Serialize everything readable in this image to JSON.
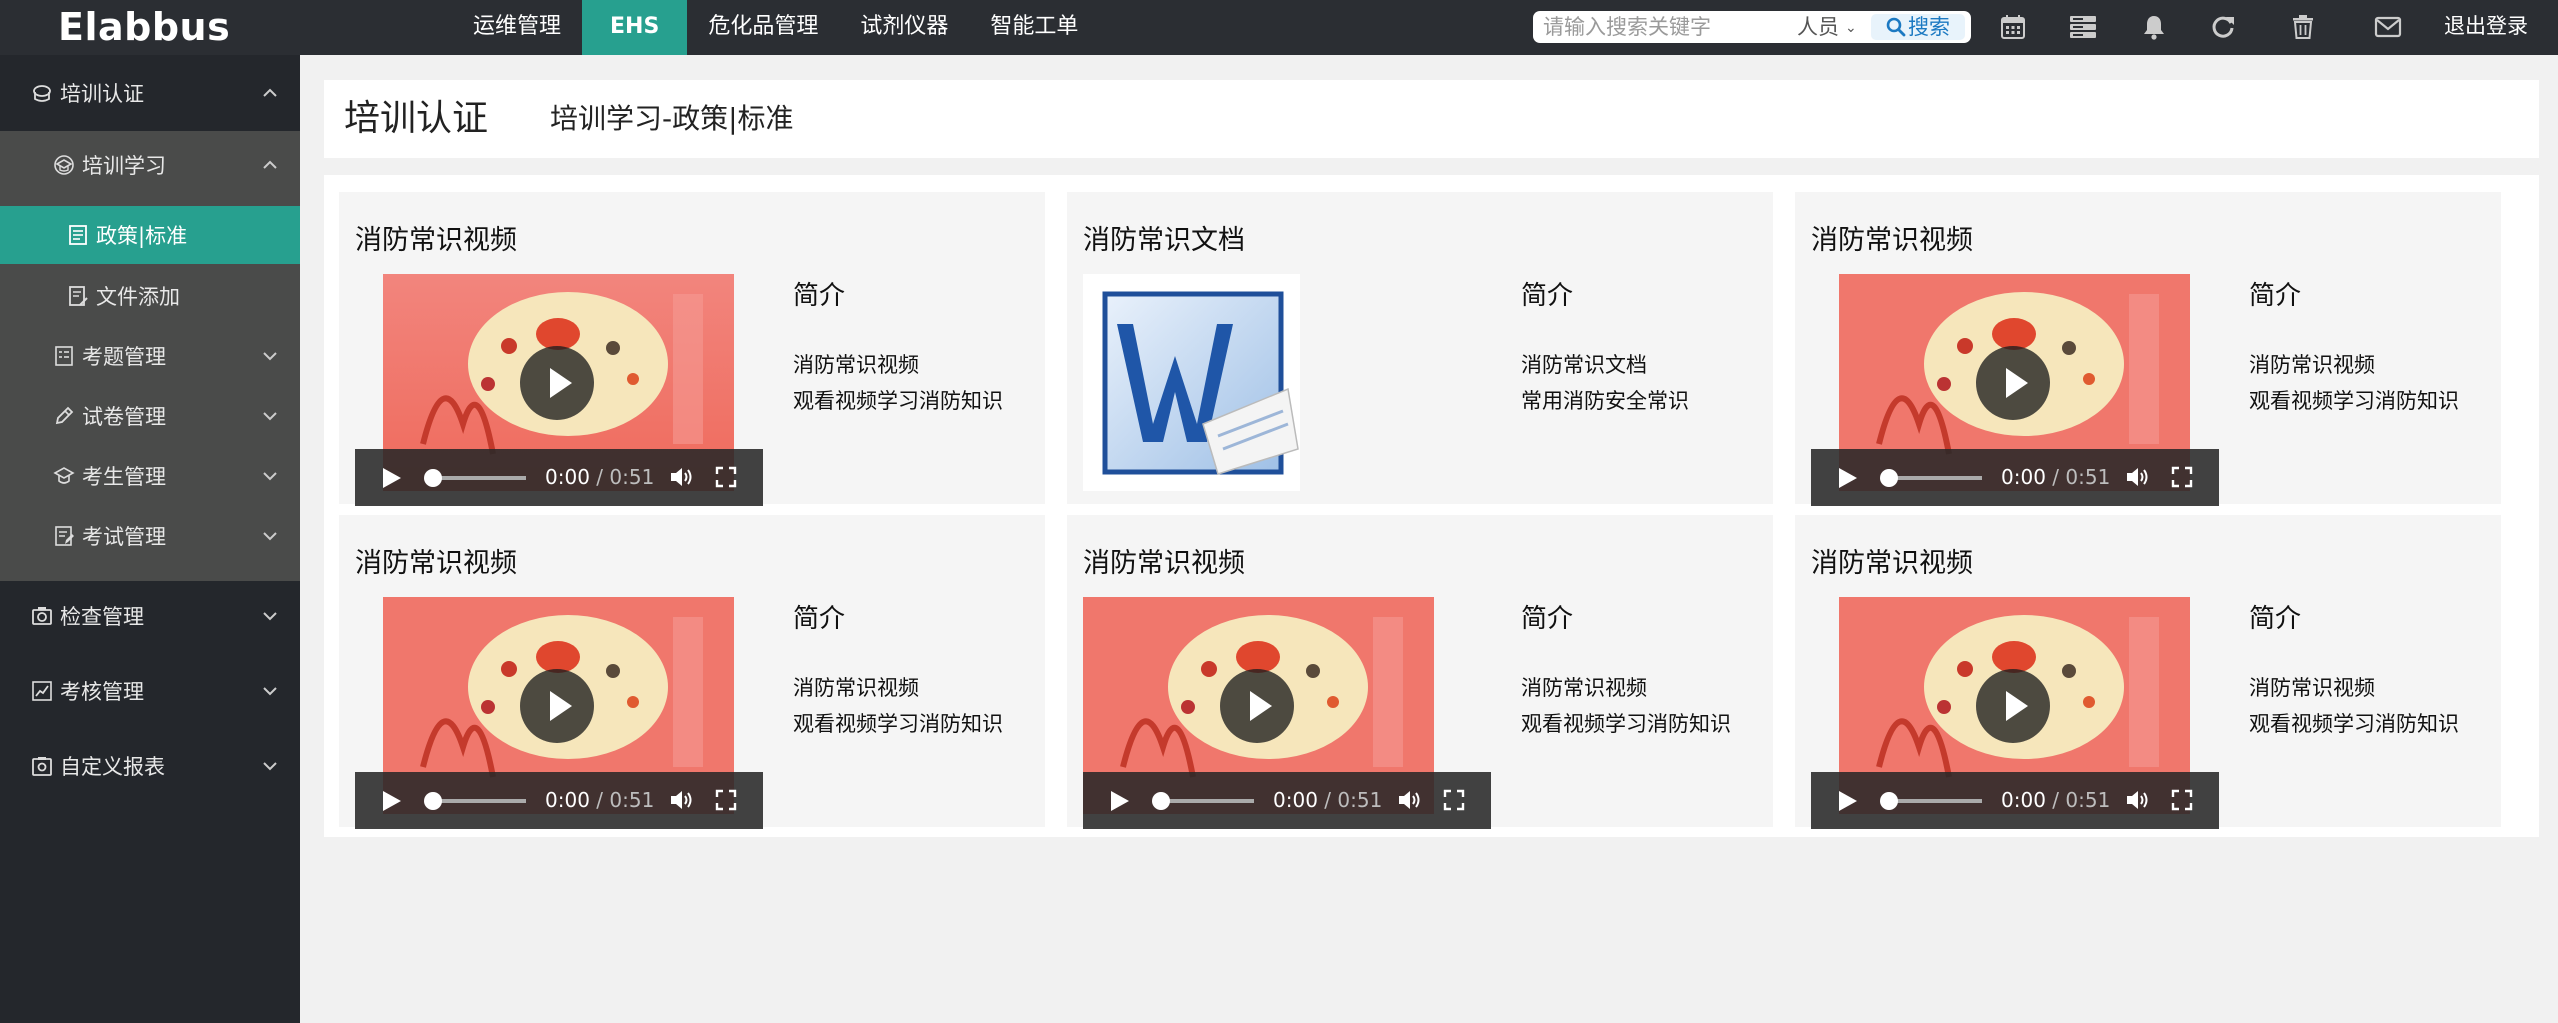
{
  "app": {
    "logo": "Elabbus",
    "nav": [
      {
        "label": "运维管理"
      },
      {
        "label": "EHS"
      },
      {
        "label": "危化品管理"
      },
      {
        "label": "试剂仪器"
      },
      {
        "label": "智能工单"
      }
    ],
    "search": {
      "placeholder": "请输入搜索关键字",
      "type": "人员",
      "button": "搜索"
    },
    "logout": "退出登录",
    "icons": [
      "calendar-icon",
      "server-icon",
      "bell-icon",
      "refresh-icon",
      "trash-icon",
      "mail-icon"
    ]
  },
  "sidebar": {
    "items": [
      {
        "label": "培训认证",
        "icon": "mortarboard-icon"
      },
      {
        "label": "培训学习",
        "icon": "graduation-icon"
      },
      {
        "label": "政策|标准",
        "icon": "book-icon"
      },
      {
        "label": "文件添加",
        "icon": "file-edit-icon"
      },
      {
        "label": "考题管理",
        "icon": "question-list-icon"
      },
      {
        "label": "试卷管理",
        "icon": "pen-icon"
      },
      {
        "label": "考生管理",
        "icon": "student-icon"
      },
      {
        "label": "考试管理",
        "icon": "exam-icon"
      },
      {
        "label": "检查管理",
        "icon": "camera-icon"
      },
      {
        "label": "考核管理",
        "icon": "chart-icon"
      },
      {
        "label": "自定义报表",
        "icon": "report-icon"
      }
    ]
  },
  "page": {
    "title": "培训认证",
    "breadcrumb": "培训学习-政策|标准"
  },
  "cards": [
    {
      "title": "消防常识视频",
      "kind": "video",
      "intro": "简介",
      "line1": "消防常识视频",
      "line2": "观看视频学习消防知识",
      "time": "0:00",
      "duration": "/ 0:51"
    },
    {
      "title": "消防常识文档",
      "kind": "document",
      "intro": "简介",
      "line1": "消防常识文档",
      "line2": "常用消防安全常识"
    },
    {
      "title": "消防常识视频",
      "kind": "video",
      "intro": "简介",
      "line1": "消防常识视频",
      "line2": "观看视频学习消防知识",
      "time": "0:00",
      "duration": "/ 0:51"
    },
    {
      "title": "消防常识视频",
      "kind": "video",
      "intro": "简介",
      "line1": "消防常识视频",
      "line2": "观看视频学习消防知识",
      "time": "0:00",
      "duration": "/ 0:51"
    },
    {
      "title": "消防常识视频",
      "kind": "video",
      "intro": "简介",
      "line1": "消防常识视频",
      "line2": "观看视频学习消防知识",
      "time": "0:00",
      "duration": "/ 0:51"
    },
    {
      "title": "消防常识视频",
      "kind": "video",
      "intro": "简介",
      "line1": "消防常识视频",
      "line2": "观看视频学习消防知识",
      "time": "0:00",
      "duration": "/ 0:51"
    }
  ],
  "colors": {
    "topbar": "#2b2e33",
    "accent": "#27a08f",
    "sidebar": "#24272c",
    "submenu": "#4a4b4a"
  }
}
